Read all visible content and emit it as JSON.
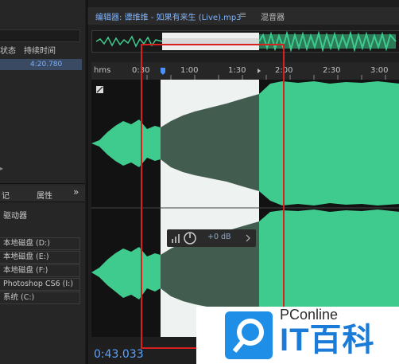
{
  "left_panel": {
    "header_status": "状态",
    "header_duration": "持续时间",
    "selected_duration": "4:20.780",
    "tab_markers": "记",
    "tab_properties": "属性",
    "more_glyph": "»",
    "drives_title": "驱动器",
    "drives": [
      "本地磁盘 (D:)",
      "本地磁盘 (E:)",
      "本地磁盘 (F:)",
      "Photoshop CS6 (I:)",
      "系统 (C:)"
    ]
  },
  "main": {
    "editor_tab": "编辑器: 谭维维 - 如果有来生 (Live).mp3",
    "menu_glyph": "≡",
    "mixer_tab": "混音器",
    "ruler_unit": "hms",
    "ruler_ticks": [
      "0:30",
      "1:00",
      "1:30",
      "2:00",
      "2:30",
      "3:00"
    ],
    "volume_db": "+0 dB",
    "timecode": "0:43.033",
    "colors": {
      "waveform": "#3ecb8d",
      "accent": "#5aa2ff",
      "annotation": "#d82020"
    }
  },
  "watermark": {
    "brand": "PConline",
    "brand_large": "IT百科"
  }
}
